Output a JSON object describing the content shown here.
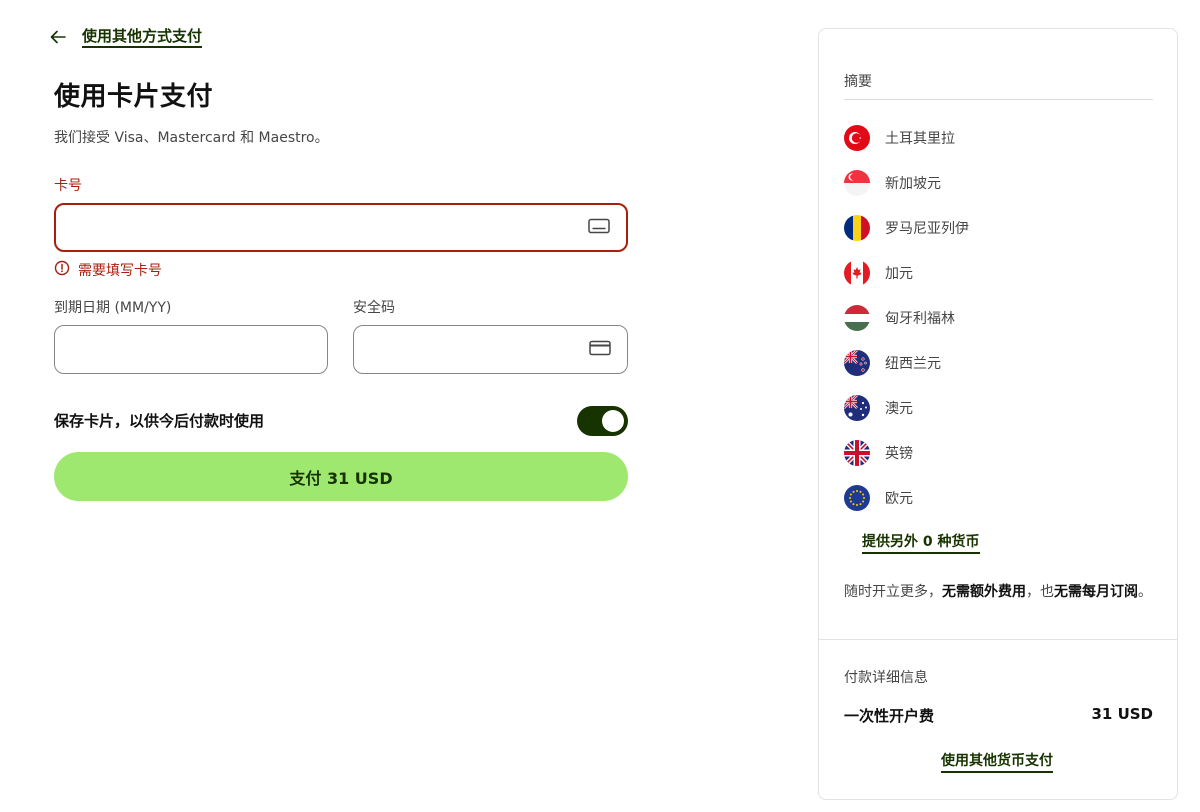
{
  "back_link": {
    "label": "使用其他方式支付"
  },
  "title": "使用卡片支付",
  "subtitle": "我们接受 Visa、Mastercard 和 Maestro。",
  "card_number": {
    "label": "卡号",
    "value": "",
    "error": "需要填写卡号"
  },
  "expiry": {
    "label": "到期日期 (MM/YY)",
    "value": ""
  },
  "cvc": {
    "label": "安全码",
    "value": ""
  },
  "save_card": {
    "label": "保存卡片，以供今后付款时使用",
    "enabled": true
  },
  "pay_button": {
    "label": "支付 31 USD"
  },
  "summary": {
    "title": "摘要",
    "currencies": [
      {
        "name": "土耳其里拉",
        "flag": "turkey-flag-icon"
      },
      {
        "name": "新加坡元",
        "flag": "singapore-flag-icon"
      },
      {
        "name": "罗马尼亚列伊",
        "flag": "romania-flag-icon"
      },
      {
        "name": "加元",
        "flag": "canada-flag-icon"
      },
      {
        "name": "匈牙利福林",
        "flag": "hungary-flag-icon"
      },
      {
        "name": "纽西兰元",
        "flag": "new-zealand-flag-icon"
      },
      {
        "name": "澳元",
        "flag": "australia-flag-icon"
      },
      {
        "name": "英镑",
        "flag": "uk-flag-icon"
      },
      {
        "name": "欧元",
        "flag": "eu-flag-icon"
      }
    ],
    "more_currencies": "提供另外 0 种货币",
    "note": {
      "part1": "随时开立更多，",
      "bold1": "无需额外费用",
      "part2": "，也",
      "bold2": "无需每月订阅",
      "part3": "。"
    },
    "payment_details_title": "付款详细信息",
    "fee_label": "一次性开户费",
    "fee_value": "31 USD",
    "other_currency_link": "使用其他货币支付"
  },
  "colors": {
    "brand_dark": "#163300",
    "brand_green": "#9fe870",
    "error": "#a8200d"
  }
}
